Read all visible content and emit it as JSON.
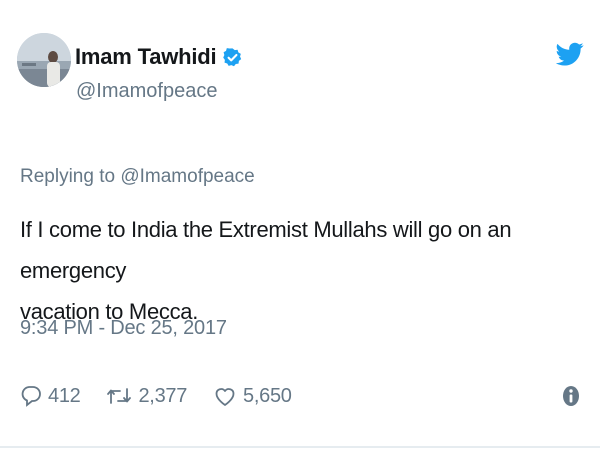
{
  "user": {
    "display_name": "Imam Tawhidi",
    "handle": "@Imamofpeace",
    "verified": true
  },
  "tweet": {
    "replying_prefix": "Replying to ",
    "replying_to": "@Imamofpeace",
    "text_line_1": "If I come to India the Extremist Mullahs will go on an emergency",
    "text_line_2": "vacation to Mecca.",
    "timestamp": "9:34 PM - Dec 25, 2017"
  },
  "stats": {
    "replies": "412",
    "retweets": "2,377",
    "likes": "5,650"
  },
  "icons": {
    "brand": "twitter-bird-icon",
    "verified": "verified-badge-icon",
    "reply": "reply-bubble-icon",
    "retweet": "retweet-icon",
    "like": "heart-icon",
    "info": "info-icon"
  },
  "colors": {
    "brand_blue": "#1da1f2",
    "secondary_text": "#657786",
    "primary_text": "#14171a"
  }
}
